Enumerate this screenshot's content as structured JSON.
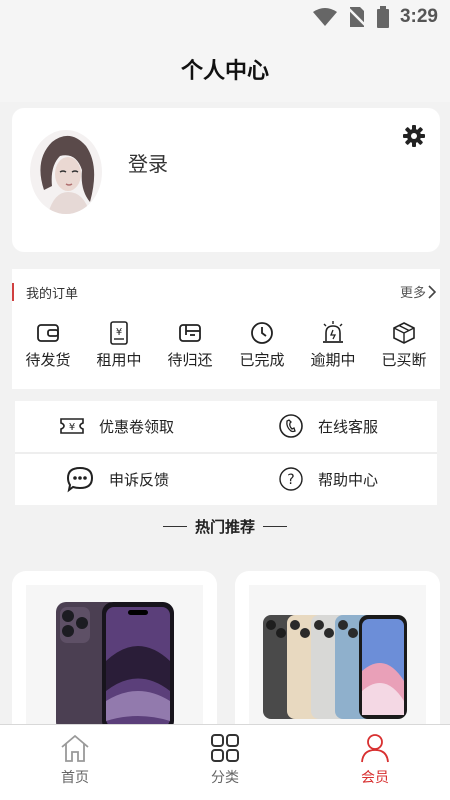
{
  "status_bar": {
    "time": "3:29"
  },
  "header": {
    "title": "个人中心"
  },
  "profile": {
    "login_label": "登录"
  },
  "orders": {
    "title": "我的订单",
    "more_label": "更多",
    "items": [
      {
        "label": "待发货",
        "icon": "wallet-icon"
      },
      {
        "label": "租用中",
        "icon": "yen-document-icon"
      },
      {
        "label": "待归还",
        "icon": "return-box-icon"
      },
      {
        "label": "已完成",
        "icon": "clock-icon"
      },
      {
        "label": "逾期中",
        "icon": "alarm-icon"
      },
      {
        "label": "已买断",
        "icon": "package-icon"
      }
    ]
  },
  "services": [
    {
      "label": "优惠卷领取",
      "icon": "coupon-icon"
    },
    {
      "label": "在线客服",
      "icon": "phone-icon"
    },
    {
      "label": "申诉反馈",
      "icon": "chat-bubble-icon"
    },
    {
      "label": "帮助中心",
      "icon": "help-icon"
    }
  ],
  "hot": {
    "title": "热门推荐"
  },
  "tabbar": {
    "items": [
      {
        "label": "首页",
        "icon": "home-icon"
      },
      {
        "label": "分类",
        "icon": "category-grid-icon"
      },
      {
        "label": "会员",
        "icon": "user-icon"
      }
    ],
    "active": "会员"
  },
  "colors": {
    "accent": "#d83030",
    "background": "#f2f2f2",
    "card": "#ffffff"
  }
}
